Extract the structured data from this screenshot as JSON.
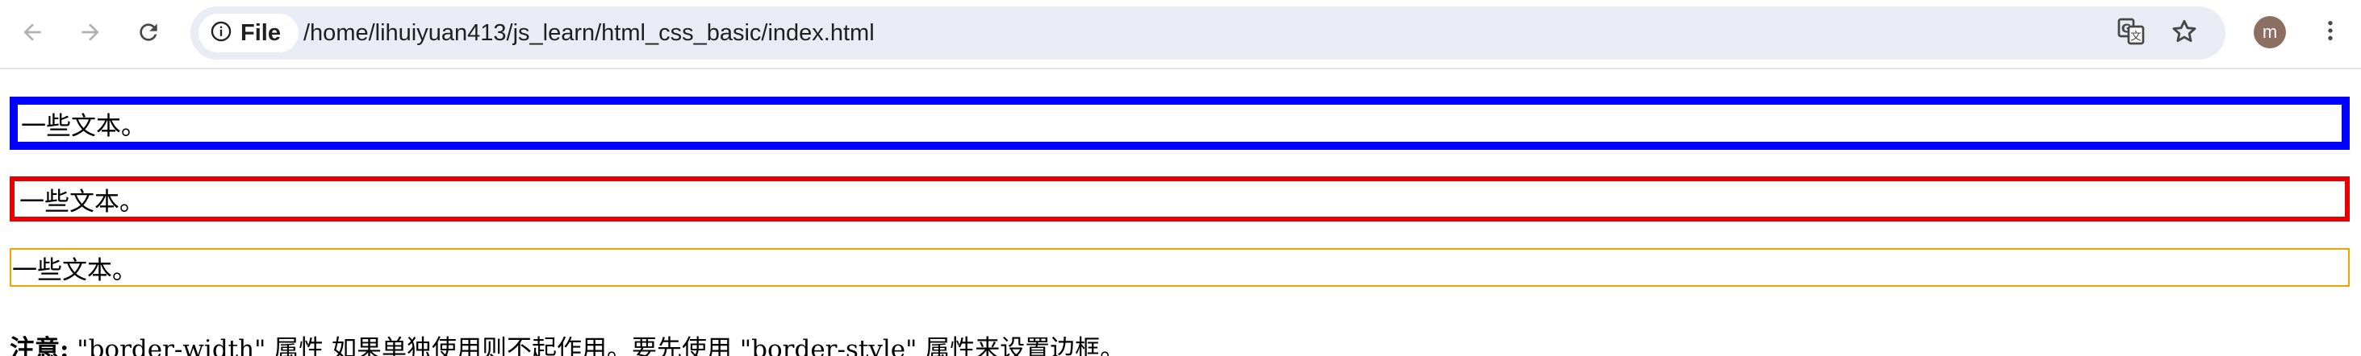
{
  "toolbar": {
    "back_icon": "arrow-left-icon",
    "forward_icon": "arrow-right-icon",
    "reload_icon": "reload-icon",
    "security_chip_label": "File",
    "security_icon": "info-circle-icon",
    "url": "/home/lihuiyuan413/js_learn/html_css_basic/index.html",
    "translate_icon": "translate-icon",
    "bookmark_icon": "star-icon",
    "profile_initial": "m",
    "menu_icon": "kebab-menu-icon",
    "colors": {
      "omnibox_bg": "#e9ecf5",
      "avatar_bg": "#8d6e63",
      "icon": "#474747"
    }
  },
  "page": {
    "boxes": [
      {
        "text": "一些文本。",
        "border_color": "#0000ff"
      },
      {
        "text": "一些文本。",
        "border_color": "#e60000"
      },
      {
        "text": "一些文本。",
        "border_color": "#f0a400"
      }
    ],
    "note": {
      "label": "注意:",
      "text": " \"border-width\" 属性 如果单独使用则不起作用。要先使用 \"border-style\" 属性来设置边框。"
    }
  }
}
